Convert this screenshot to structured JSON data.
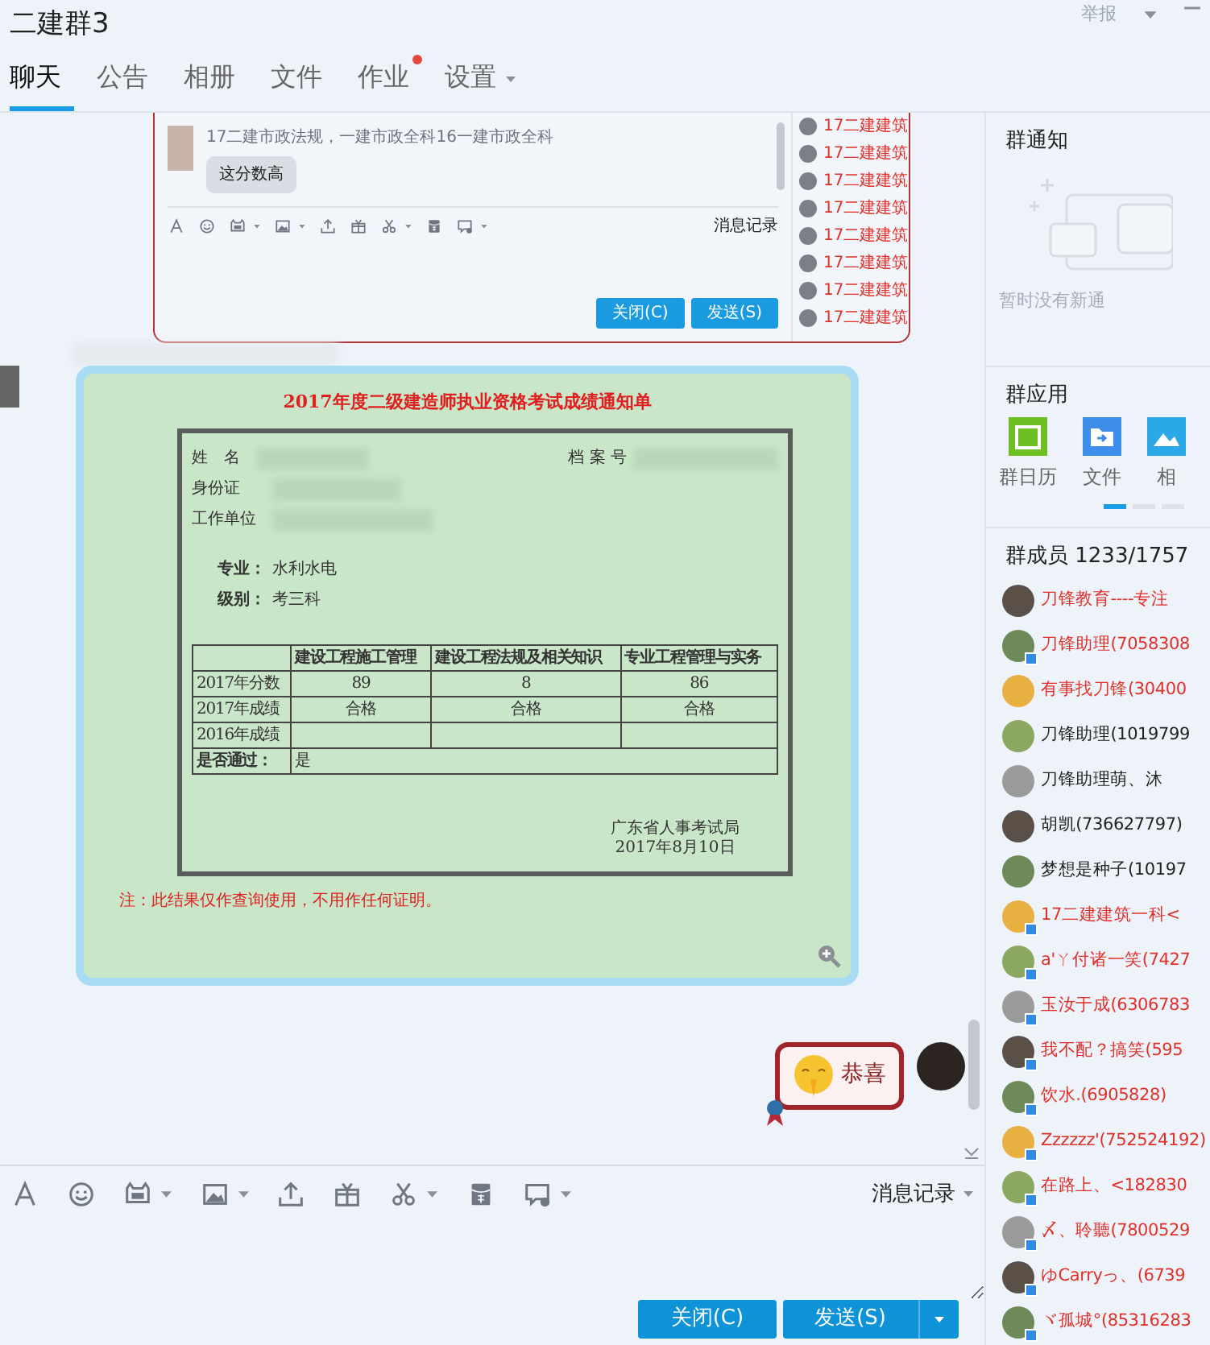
{
  "window": {
    "title": "二建群3",
    "report": "举报"
  },
  "tabs": [
    {
      "label": "聊天",
      "selected": true,
      "dot": false,
      "menu": false
    },
    {
      "label": "公告",
      "selected": false,
      "dot": false,
      "menu": false
    },
    {
      "label": "相册",
      "selected": false,
      "dot": false,
      "menu": false
    },
    {
      "label": "文件",
      "selected": false,
      "dot": false,
      "menu": false
    },
    {
      "label": "作业",
      "selected": false,
      "dot": true,
      "menu": false
    },
    {
      "label": "设置",
      "selected": false,
      "dot": false,
      "menu": true
    }
  ],
  "chat": {
    "messages": [
      {
        "kind": "screenshot",
        "sender": "17二建市政法规，一建市政全科16一建市政全科",
        "bubble": "这分数高",
        "history": "消息记录",
        "close_button": "关闭(C)",
        "send_button": "发送(S)",
        "members": [
          "17二建建筑",
          "17二建建筑",
          "17二建建筑",
          "17二建建筑",
          "17二建建筑",
          "17二建建筑",
          "17二建建筑",
          "17二建建筑"
        ]
      },
      {
        "kind": "image",
        "title": "2017年度二级建造师执业资格考试成绩通知单",
        "fields": [
          "姓　名",
          "档 案 号",
          "身份证",
          "工作单位"
        ],
        "details": [
          {
            "label": "专业：",
            "value": "水利水电"
          },
          {
            "label": "级别：",
            "value": "考三科"
          }
        ],
        "columns": [
          "",
          "建设工程施工管理",
          "建设工程法规及相关知识",
          "专业工程管理与实务"
        ],
        "rows": [
          [
            "2017年分数",
            "89",
            "8",
            "86"
          ],
          [
            "2017年成绩",
            "合格",
            "合格",
            "合格"
          ],
          [
            "2016年成绩",
            "",
            "",
            ""
          ]
        ],
        "passed": {
          "label": "是否通过：",
          "value": "是"
        },
        "issuer": "广东省人事考试局",
        "date": "2017年8月10日",
        "note": "注：此结果仅作查询使用，不用作任何证明。"
      },
      {
        "kind": "sticker",
        "text": "恭喜"
      }
    ]
  },
  "composer": {
    "history": "消息记录",
    "close_button": "关闭(C)",
    "send_button": "发送(S)"
  },
  "sidebar": {
    "notice": {
      "title": "群通知",
      "empty": "暂时没有新通"
    },
    "apps": {
      "title": "群应用",
      "items": [
        {
          "kind": "calendar",
          "label": "群日历"
        },
        {
          "kind": "files",
          "label": "文件"
        },
        {
          "kind": "album",
          "label": "相"
        }
      ],
      "pages": [
        {
          "selected": true
        },
        {
          "selected": false
        },
        {
          "selected": false
        }
      ]
    },
    "members": {
      "title": "群成员 1233/1757",
      "items": [
        {
          "name": "刀锋教育----专注",
          "color": "#e0302a",
          "mobile": false
        },
        {
          "name": "刀锋助理(7058308",
          "color": "#e0302a",
          "mobile": true
        },
        {
          "name": "有事找刀锋(30400",
          "color": "#e0302a",
          "mobile": false
        },
        {
          "name": "刀锋助理(1019799",
          "color": "#222222",
          "mobile": false
        },
        {
          "name": "刀锋助理萌、沐",
          "color": "#222222",
          "mobile": false
        },
        {
          "name": "胡凯(736627797)",
          "color": "#222222",
          "mobile": false
        },
        {
          "name": "梦想是种子(10197",
          "color": "#222222",
          "mobile": false
        },
        {
          "name": "17二建建筑一科<",
          "color": "#e0302a",
          "mobile": true
        },
        {
          "name": "a'ㄚ付诸一笑(7427",
          "color": "#e0302a",
          "mobile": true
        },
        {
          "name": "玉汝于成(6306783",
          "color": "#e0302a",
          "mobile": true
        },
        {
          "name": "我不配？搞笑(595",
          "color": "#e0302a",
          "mobile": true
        },
        {
          "name": "饮水.(6905828)",
          "color": "#e0302a",
          "mobile": true
        },
        {
          "name": "Zzzzzz'(752524192)",
          "color": "#e0302a",
          "mobile": true
        },
        {
          "name": "在路上、<182830",
          "color": "#e0302a",
          "mobile": true
        },
        {
          "name": "〆、聆聽(7800529",
          "color": "#e0302a",
          "mobile": true
        },
        {
          "name": "ゆCarryっ、(6739",
          "color": "#e0302a",
          "mobile": true
        },
        {
          "name": "ヾ孤城°(85316283",
          "color": "#e0302a",
          "mobile": true
        }
      ]
    }
  }
}
